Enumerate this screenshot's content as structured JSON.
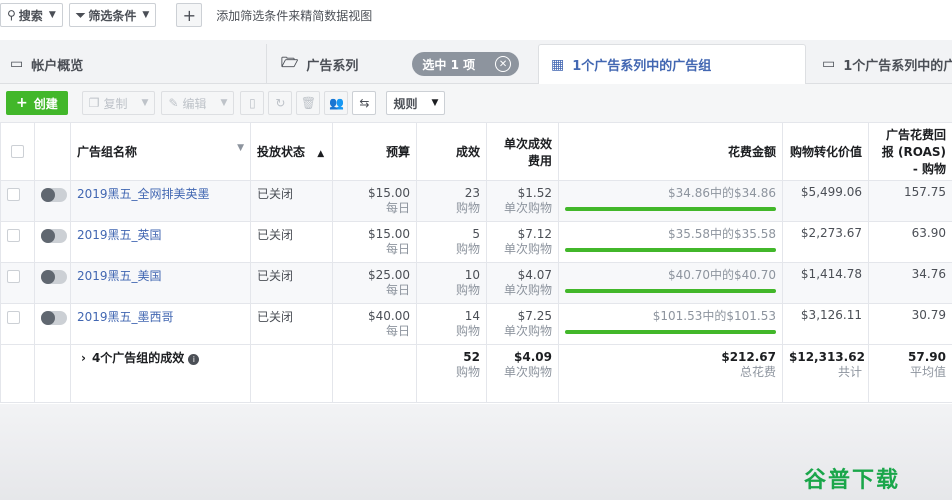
{
  "filterbar": {
    "search": "搜索",
    "filter": "筛选条件",
    "hint": "添加筛选条件来精简数据视图"
  },
  "tabs": {
    "account": "帐户概览",
    "campaigns": "广告系列",
    "selected_pill": "选中 1 项",
    "adsets": "1个广告系列中的广告组",
    "ads": "1个广告系列中的广"
  },
  "toolbar": {
    "create": "创建",
    "copy": "复制",
    "edit": "编辑",
    "rules": "规则"
  },
  "columns": {
    "name": "广告组名称",
    "status": "投放状态",
    "budget": "预算",
    "results": "成效",
    "cost_per": "单次成效费用",
    "spent": "花费金额",
    "conv_value": "购物转化价值",
    "roas": "广告花费回报 (ROAS) - 购物"
  },
  "rows": [
    {
      "name": "2019黑五_全网排美英墨",
      "status": "已关闭",
      "budget": "$15.00",
      "budget_unit": "每日",
      "results": "23",
      "results_unit": "购物",
      "cost": "$1.52",
      "cost_unit": "单次购物",
      "spent_text": "$34.86中的$34.86",
      "spent_fraction": 1.0,
      "value": "$5,499.06",
      "roas": "157.75"
    },
    {
      "name": "2019黑五_英国",
      "status": "已关闭",
      "budget": "$15.00",
      "budget_unit": "每日",
      "results": "5",
      "results_unit": "购物",
      "cost": "$7.12",
      "cost_unit": "单次购物",
      "spent_text": "$35.58中的$35.58",
      "spent_fraction": 1.0,
      "value": "$2,273.67",
      "roas": "63.90"
    },
    {
      "name": "2019黑五_美国",
      "status": "已关闭",
      "budget": "$25.00",
      "budget_unit": "每日",
      "results": "10",
      "results_unit": "购物",
      "cost": "$4.07",
      "cost_unit": "单次购物",
      "spent_text": "$40.70中的$40.70",
      "spent_fraction": 1.0,
      "value": "$1,414.78",
      "roas": "34.76"
    },
    {
      "name": "2019黑五_墨西哥",
      "status": "已关闭",
      "budget": "$40.00",
      "budget_unit": "每日",
      "results": "14",
      "results_unit": "购物",
      "cost": "$7.25",
      "cost_unit": "单次购物",
      "spent_text": "$101.53中的$101.53",
      "spent_fraction": 1.0,
      "value": "$3,126.11",
      "roas": "30.79"
    }
  ],
  "totals": {
    "label": "4个广告组的成效",
    "results": "52",
    "results_unit": "购物",
    "cost": "$4.09",
    "cost_unit": "单次购物",
    "spent": "$212.67",
    "spent_unit": "总花费",
    "value": "$12,313.62",
    "value_unit": "共计",
    "roas": "57.90",
    "roas_unit": "平均值"
  },
  "watermark": "谷普下载",
  "colors": {
    "accent": "#4267b2",
    "create": "#42b72a",
    "progress": "#42b72a"
  }
}
